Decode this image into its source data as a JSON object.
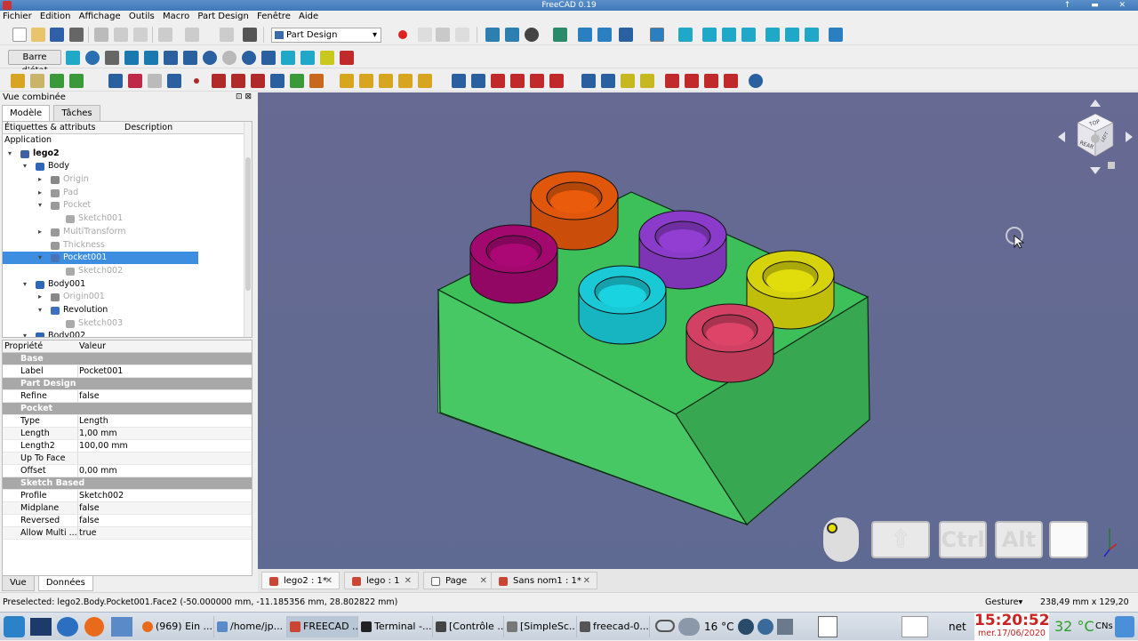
{
  "window": {
    "title": "FreeCAD 0.19",
    "controls": "↑ ▬ ✕"
  },
  "menu": [
    "Fichier",
    "Edition",
    "Affichage",
    "Outils",
    "Macro",
    "Part Design",
    "Fenêtre",
    "Aide"
  ],
  "toolbar": {
    "workbench": "Part Design",
    "statusbar_button": "Barre d'état"
  },
  "combo": {
    "title": "Vue combinée",
    "controls": "⊡ ⊠",
    "tabs": [
      "Modèle",
      "Tâches"
    ],
    "tree_headers": [
      "Étiquettes & attributs",
      "Description"
    ],
    "tree": [
      {
        "label": "Application",
        "level": -1,
        "arrow": "",
        "icon": "",
        "dim": false,
        "selected": false,
        "bold": false
      },
      {
        "label": "lego2",
        "level": 0,
        "arrow": "▾",
        "icon": "#3f5fa6",
        "dim": false,
        "selected": false,
        "bold": true
      },
      {
        "label": "Body",
        "level": 1,
        "arrow": "▾",
        "icon": "#2f66b5",
        "dim": false,
        "selected": false,
        "bold": false
      },
      {
        "label": "Origin",
        "level": 2,
        "arrow": "▸",
        "icon": "#888",
        "dim": true,
        "selected": false,
        "bold": false
      },
      {
        "label": "Pad",
        "level": 2,
        "arrow": "▸",
        "icon": "#999",
        "dim": true,
        "selected": false,
        "bold": false
      },
      {
        "label": "Pocket",
        "level": 2,
        "arrow": "▾",
        "icon": "#999",
        "dim": true,
        "selected": false,
        "bold": false
      },
      {
        "label": "Sketch001",
        "level": 3,
        "arrow": "",
        "icon": "#aaa",
        "dim": true,
        "selected": false,
        "bold": false
      },
      {
        "label": "MultiTransform",
        "level": 2,
        "arrow": "▸",
        "icon": "#999",
        "dim": true,
        "selected": false,
        "bold": false
      },
      {
        "label": "Thickness",
        "level": 2,
        "arrow": "",
        "icon": "#999",
        "dim": true,
        "selected": false,
        "bold": false
      },
      {
        "label": "Pocket001",
        "level": 2,
        "arrow": "▾",
        "icon": "#4a72b8",
        "dim": false,
        "selected": true,
        "bold": false
      },
      {
        "label": "Sketch002",
        "level": 3,
        "arrow": "",
        "icon": "#aaa",
        "dim": true,
        "selected": false,
        "bold": false
      },
      {
        "label": "Body001",
        "level": 1,
        "arrow": "▾",
        "icon": "#2f66b5",
        "dim": false,
        "selected": false,
        "bold": false
      },
      {
        "label": "Origin001",
        "level": 2,
        "arrow": "▸",
        "icon": "#888",
        "dim": true,
        "selected": false,
        "bold": false
      },
      {
        "label": "Revolution",
        "level": 2,
        "arrow": "▾",
        "icon": "#3f6fc0",
        "dim": false,
        "selected": false,
        "bold": false
      },
      {
        "label": "Sketch003",
        "level": 3,
        "arrow": "",
        "icon": "#aaa",
        "dim": true,
        "selected": false,
        "bold": false
      },
      {
        "label": "Body002",
        "level": 1,
        "arrow": "▾",
        "icon": "#2f66b5",
        "dim": false,
        "selected": false,
        "bold": false
      }
    ],
    "prop_headers": [
      "Propriété",
      "Valeur"
    ],
    "properties": [
      {
        "group": "Base"
      },
      {
        "name": "Label",
        "value": "Pocket001"
      },
      {
        "group": "Part Design"
      },
      {
        "name": "Refine",
        "value": "false"
      },
      {
        "group": "Pocket"
      },
      {
        "name": "Type",
        "value": "Length"
      },
      {
        "name": "Length",
        "value": "1,00 mm"
      },
      {
        "name": "Length2",
        "value": "100,00 mm"
      },
      {
        "name": "Up To Face",
        "value": ""
      },
      {
        "name": "Offset",
        "value": "0,00 mm"
      },
      {
        "group": "Sketch Based"
      },
      {
        "name": "Profile",
        "value": "Sketch002"
      },
      {
        "name": "Midplane",
        "value": "false"
      },
      {
        "name": "Reversed",
        "value": "false"
      },
      {
        "name": "Allow Multi ...",
        "value": "true"
      }
    ],
    "bottom_tabs": [
      "Vue",
      "Données"
    ]
  },
  "viewport": {
    "navcube": {
      "face_top": "TOP",
      "face_front": "REAR",
      "face_right": "LEFT"
    },
    "keys": [
      "Ctrl",
      "Alt"
    ],
    "colors": {
      "brick": "#3fbf5c",
      "orange": "#e0570b",
      "purple": "#8b3bc9",
      "magenta": "#a3086f",
      "cyan": "#19c9d6",
      "yellow": "#d6d20c",
      "pink": "#d24163"
    }
  },
  "doc_tabs": [
    "lego2 : 1*",
    "lego : 1",
    "Page",
    "Sans nom1 : 1*"
  ],
  "status": {
    "preselect": "Preselected: lego2.Body.Pocket001.Face2 (-50.000000 mm, -11.185356 mm, 28.802822 mm)",
    "nav": "Gesture▾",
    "dims": "238,49 mm x 129,20 mm"
  },
  "taskbar": {
    "tasks": [
      "(969) Ein ...",
      "/home/jp...",
      "FREECAD ...",
      "Terminal -...",
      "[Contrôle ...",
      "[SimpleSc...",
      "freecad-0..."
    ],
    "weather": "16 °C",
    "net": "net",
    "time": "15:20:52",
    "date": "mer.17/06/2020",
    "temp": "32 °C",
    "extra": "CNs"
  }
}
